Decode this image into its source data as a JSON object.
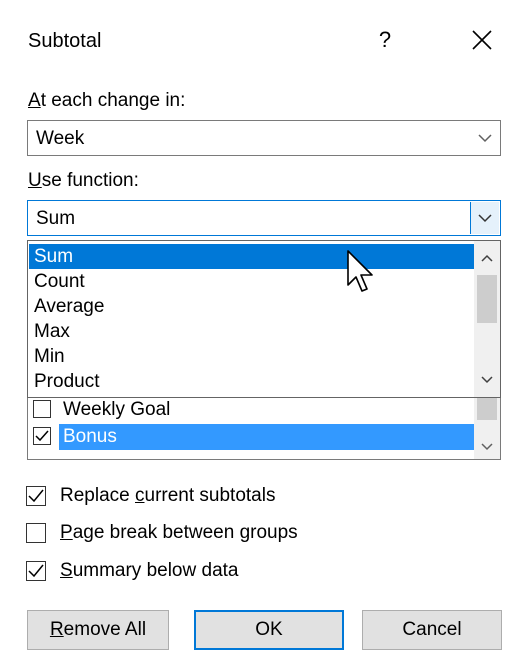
{
  "dialog": {
    "title": "Subtotal",
    "help_label": "?",
    "close_label": "✕"
  },
  "change_in": {
    "label_accel": "A",
    "label_rest": "t each change in:",
    "value": "Week"
  },
  "use_function": {
    "label_accel": "U",
    "label_rest": "se function:",
    "value": "Sum",
    "options": [
      "Sum",
      "Count",
      "Average",
      "Max",
      "Min",
      "Product"
    ],
    "selected_index": 0
  },
  "add_subtotal_to": {
    "items": [
      {
        "label": "Weekly Goal",
        "checked": false,
        "selected": false
      },
      {
        "label": "Bonus",
        "checked": true,
        "selected": true
      }
    ]
  },
  "options": {
    "replace": {
      "pre": "Replace ",
      "accel": "c",
      "post": "urrent subtotals",
      "checked": true
    },
    "page_break": {
      "pre": "",
      "accel": "P",
      "post": "age break between groups",
      "checked": false
    },
    "summary": {
      "pre": "",
      "accel": "S",
      "post": "ummary below data",
      "checked": true
    }
  },
  "buttons": {
    "remove_all": {
      "accel": "R",
      "rest": "emove All"
    },
    "ok": "OK",
    "cancel": "Cancel"
  },
  "colors": {
    "selection_blue": "#0078d7",
    "list_highlight": "#3399ff",
    "focus_border": "#0078d7"
  }
}
